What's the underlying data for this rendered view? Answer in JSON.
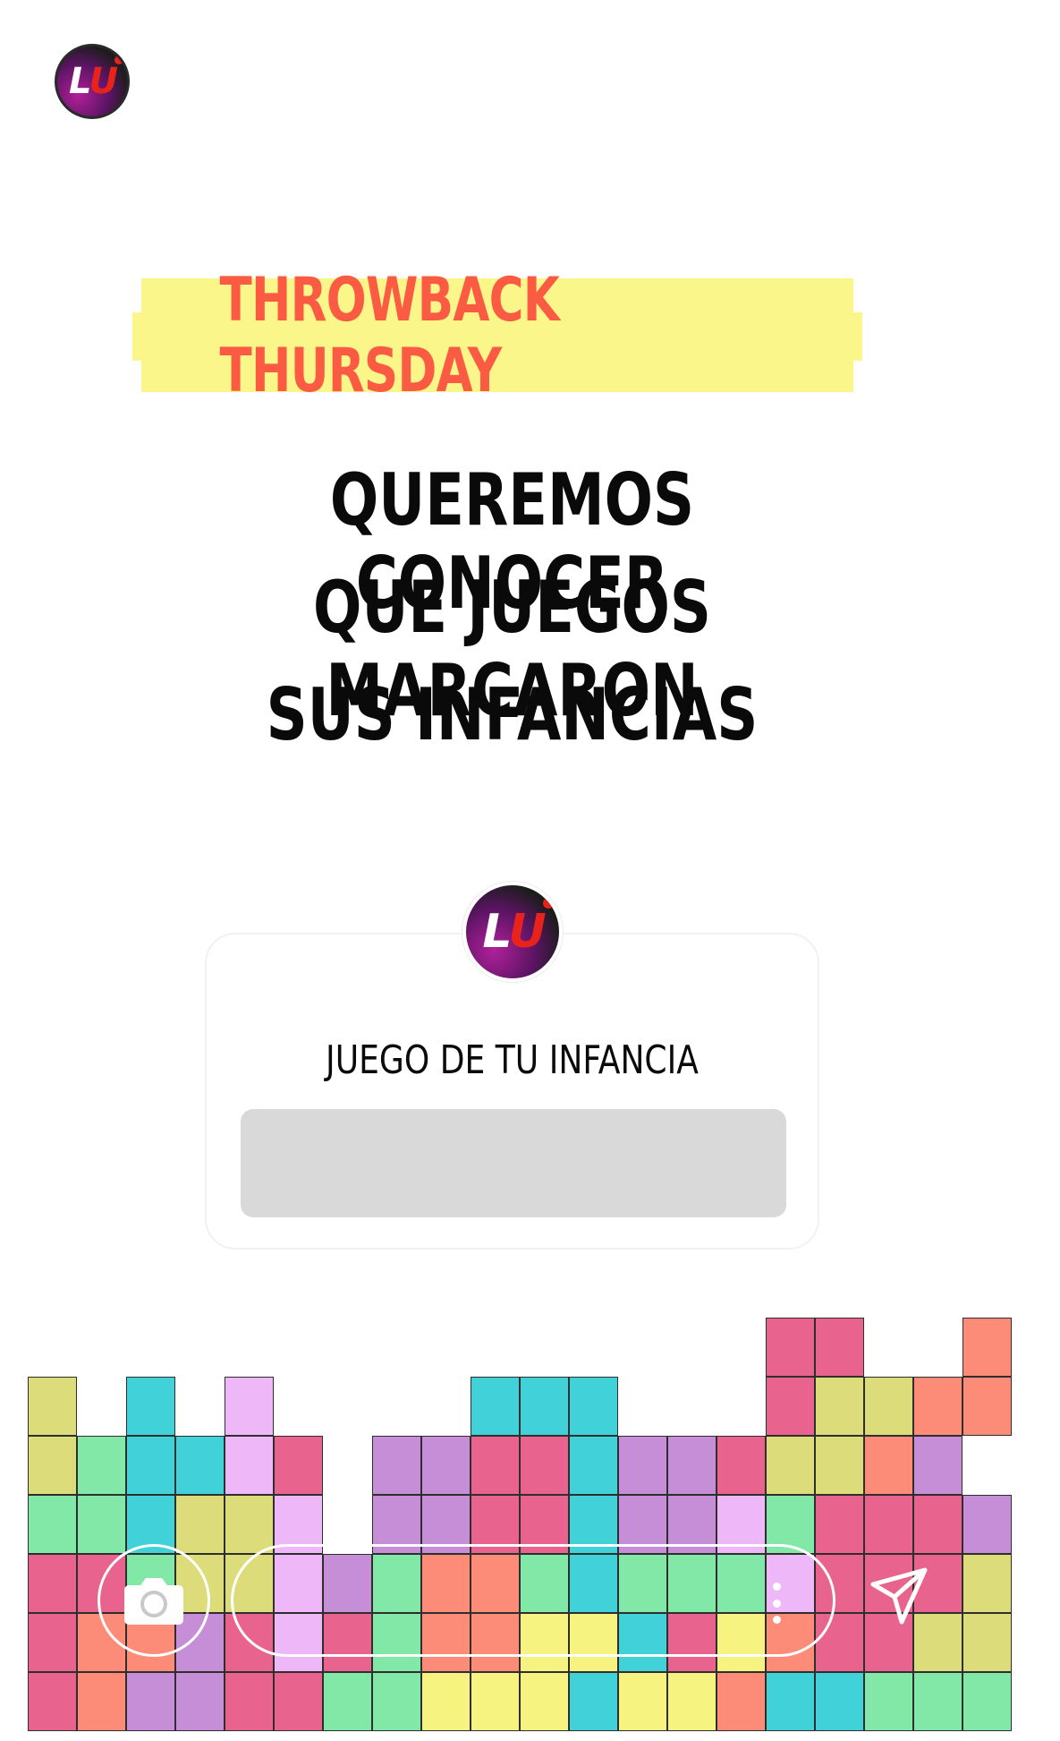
{
  "header": {
    "avatar_icon": "brand-avatar-icon",
    "avatar_letters": {
      "first": "L",
      "second": "U"
    }
  },
  "banner": {
    "text": "THROWBACK THURSDAY",
    "background": "#faf68a",
    "text_color": "#fb5b43"
  },
  "headline": {
    "lines": [
      "QUEREMOS CONOCER",
      "QUE JUEGOS MARCARON",
      "SUS INFANCIAS"
    ]
  },
  "question_sticker": {
    "prompt": "JUEGO DE TU INFANCIA",
    "answer_value": "",
    "avatar_letters": {
      "first": "L",
      "second": "U"
    }
  },
  "footer": {
    "camera_icon": "camera-icon",
    "more_icon": "more-vertical-icon",
    "send_icon": "send-icon"
  },
  "block_colors": {
    "olive": "#dcdc7a",
    "cyan": "#41d1d8",
    "mint": "#82e8a8",
    "lavender": "#eeb8f8",
    "purple": "#c58ed7",
    "pink": "#e8648e",
    "coral": "#fc8c78",
    "yellow": "#f6f380"
  }
}
